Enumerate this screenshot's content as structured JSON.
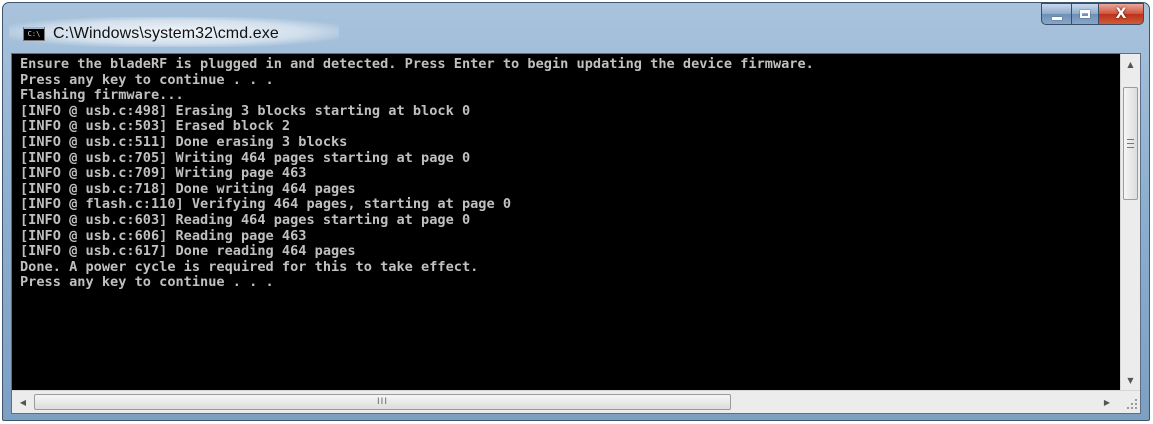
{
  "window": {
    "title": "C:\\Windows\\system32\\cmd.exe",
    "app_icon_label": "C:\\",
    "buttons": {
      "minimize": "minimize",
      "maximize": "maximize",
      "close": "close"
    }
  },
  "console": {
    "lines": [
      "Ensure the bladeRF is plugged in and detected. Press Enter to begin updating the device firmware.",
      "Press any key to continue . . .",
      "Flashing firmware...",
      "[INFO @ usb.c:498] Erasing 3 blocks starting at block 0",
      "[INFO @ usb.c:503] Erased block 2",
      "[INFO @ usb.c:511] Done erasing 3 blocks",
      "[INFO @ usb.c:705] Writing 464 pages starting at page 0",
      "[INFO @ usb.c:709] Writing page 463",
      "[INFO @ usb.c:718] Done writing 464 pages",
      "[INFO @ flash.c:110] Verifying 464 pages, starting at page 0",
      "[INFO @ usb.c:603] Reading 464 pages starting at page 0",
      "[INFO @ usb.c:606] Reading page 463",
      "[INFO @ usb.c:617] Done reading 464 pages",
      "Done. A power cycle is required for this to take effect.",
      "Press any key to continue . . ."
    ]
  },
  "colors": {
    "console_background": "#000000",
    "console_text": "#c0c0c0",
    "window_frame": "#8fb0cf",
    "close_button": "#c8452c"
  },
  "icons": {
    "scroll_up": "▲",
    "scroll_down": "▼",
    "scroll_left": "◀",
    "scroll_right": "▶",
    "h_grip": "III"
  }
}
